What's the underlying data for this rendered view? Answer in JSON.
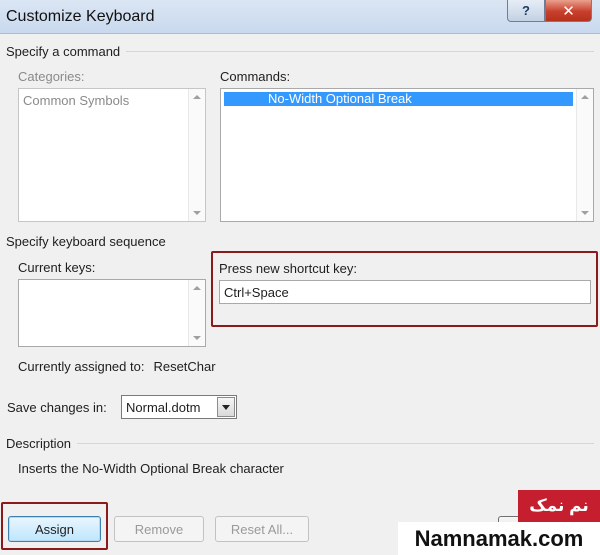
{
  "window": {
    "title": "Customize Keyboard",
    "help_glyph": "?",
    "close_glyph": "✕"
  },
  "command_group": {
    "header": "Specify a command",
    "categories_label": "Categories:",
    "categories_items": [
      "Common Symbols"
    ],
    "commands_label": "Commands:",
    "commands_items": [
      "No-Width Optional Break"
    ]
  },
  "sequence_group": {
    "header": "Specify keyboard sequence",
    "current_keys_label": "Current keys:",
    "new_key_label": "Press new shortcut key:",
    "new_key_value": "Ctrl+Space",
    "assigned_label": "Currently assigned to:",
    "assigned_value": "ResetChar"
  },
  "save": {
    "label": "Save changes in:",
    "value": "Normal.dotm"
  },
  "description": {
    "header": "Description",
    "text": "Inserts the No-Width Optional Break character"
  },
  "buttons": {
    "assign": "Assign",
    "remove": "Remove",
    "reset_all": "Reset All..."
  },
  "watermark": {
    "fa": "نم نمک",
    "en": "Namnamak.com"
  },
  "colors": {
    "selection": "#3399ff",
    "highlight_border": "#8b1a1a",
    "watermark_red": "#c51f2f"
  }
}
